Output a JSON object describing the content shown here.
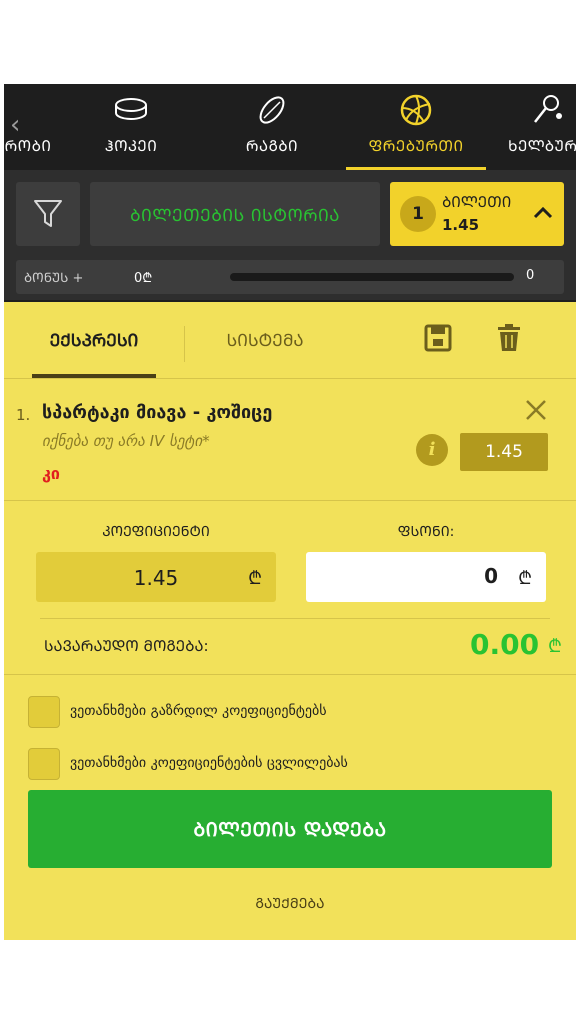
{
  "sport_nav": {
    "tabs": [
      {
        "label": "ᲠᲝᲑᲘ",
        "icon": "sport-icon"
      },
      {
        "label": "ᲰᲝᲙᲔᲘ",
        "icon": "hockey-puck-icon"
      },
      {
        "label": "ᲠᲐᲒᲑᲘ",
        "icon": "rugby-ball-icon"
      },
      {
        "label": "ᲤᲠᲔᲑᲣᲠᲗᲘ",
        "icon": "volleyball-icon",
        "active": true
      },
      {
        "label": "ᲮᲔᲚᲑᲣᲠ",
        "icon": "badminton-icon"
      }
    ]
  },
  "tools": {
    "filter_icon": "filter-icon",
    "history_label": "ᲑᲘᲚᲔᲗᲔᲑᲘᲡ ᲘᲡᲢᲝᲠᲘᲐ",
    "ticket": {
      "count": "1",
      "title": "ᲑᲘᲚᲔᲗᲘ",
      "odds": "1.45"
    }
  },
  "bonus": {
    "label": "ᲑᲝᲜᲣᲡ +",
    "amount": "0₾",
    "end_value": "0",
    "progress": 0
  },
  "betslip": {
    "tabs": {
      "express": "ᲔᲥᲡᲞᲠᲔᲡᲘ",
      "system": "ᲡᲘᲡᲢᲔᲛᲐ"
    },
    "event": {
      "number": "1.",
      "title": "სპარტაკი მიავა - კოშიცე",
      "market": "იქნება თუ არა IV სეტი*",
      "pick": "კი",
      "odds": "1.45"
    },
    "coef_label": "ᲙᲝᲔᲤᲘᲪᲘᲔᲜᲢᲘ",
    "coef_value": "1.45",
    "stake_label": "ᲤᲡᲝᲜᲘ:",
    "stake_value": "0",
    "currency": "₾",
    "win_label": "ᲡᲐᲕᲐᲠᲐᲣᲓᲝ ᲛᲝᲒᲔᲑᲐ:",
    "win_value": "0.00",
    "checkbox_1": "ვეთანხმები გაზრდილ კოეფიციენტებს",
    "checkbox_2": "ვეთანხმები კოეფიციენტების ცვლილებას",
    "place_label": "ᲑᲘᲚᲔᲗᲘᲡ ᲓᲐᲓᲔᲑᲐ",
    "cancel_label": "ᲒᲐᲣᲥᲛᲔᲑᲐ"
  },
  "colors": {
    "accent": "#f2d22b",
    "slip_bg": "#f2e15a",
    "green": "#27ae32",
    "pick_red": "#e11f1f"
  }
}
